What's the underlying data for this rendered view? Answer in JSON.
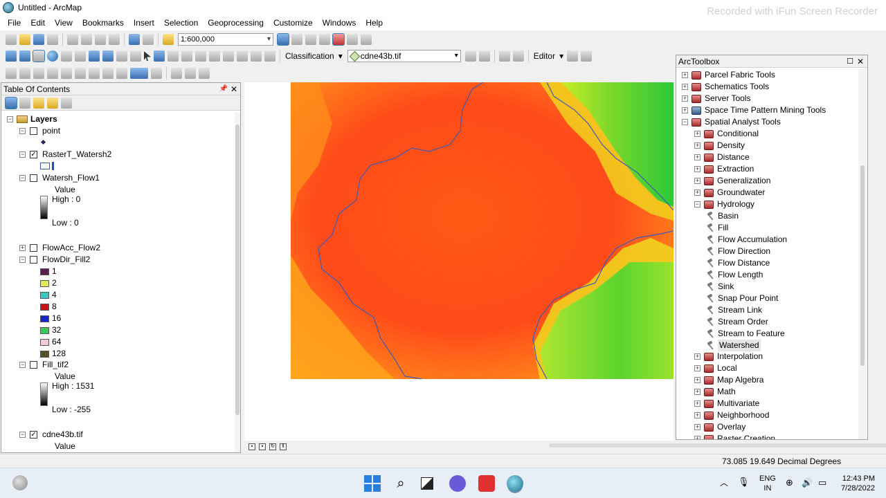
{
  "window": {
    "title": "Untitled - ArcMap",
    "watermark": "Recorded with iFun Screen Recorder"
  },
  "menu": [
    "File",
    "Edit",
    "View",
    "Bookmarks",
    "Insert",
    "Selection",
    "Geoprocessing",
    "Customize",
    "Windows",
    "Help"
  ],
  "toolbar": {
    "scale": "1:600,000",
    "classification_label": "Classification",
    "layer_select": "cdne43b.tif",
    "editor_label": "Editor"
  },
  "toc": {
    "title": "Table Of Contents",
    "root_label": "Layers",
    "layers": {
      "point": {
        "name": "point",
        "checked": false
      },
      "raster_t": {
        "name": "RasterT_Watersh2",
        "checked": true
      },
      "watersh": {
        "name": "Watersh_Flow1",
        "checked": false,
        "value_label": "Value",
        "high": "High : 0",
        "low": "Low : 0"
      },
      "flowacc": {
        "name": "FlowAcc_Flow2",
        "checked": false
      },
      "flowdir": {
        "name": "FlowDir_Fill2",
        "checked": false,
        "classes": [
          {
            "label": "1",
            "color": "#5a1e4a"
          },
          {
            "label": "2",
            "color": "#e6e65a"
          },
          {
            "label": "4",
            "color": "#3cc8c0"
          },
          {
            "label": "8",
            "color": "#c81414"
          },
          {
            "label": "16",
            "color": "#1428c8"
          },
          {
            "label": "32",
            "color": "#3cc85a"
          },
          {
            "label": "64",
            "color": "#f5c8e0"
          },
          {
            "label": "128",
            "color": "#5a5028"
          }
        ]
      },
      "fill": {
        "name": "Fill_tif2",
        "checked": false,
        "value_label": "Value",
        "high": "High : 1531",
        "low": "Low : -255"
      },
      "cdne": {
        "name": "cdne43b.tif",
        "checked": true,
        "value_label": "Value"
      }
    }
  },
  "toolbox": {
    "title": "ArcToolbox",
    "items": {
      "parcel": "Parcel Fabric Tools",
      "schematics": "Schematics Tools",
      "server": "Server Tools",
      "spacetime": "Space Time Pattern Mining Tools",
      "spatial": "Spatial Analyst Tools",
      "conditional": "Conditional",
      "density": "Density",
      "distance": "Distance",
      "extraction": "Extraction",
      "generalization": "Generalization",
      "groundwater": "Groundwater",
      "hydrology": "Hydrology",
      "interpolation": "Interpolation",
      "local": "Local",
      "mapalgebra": "Map Algebra",
      "math": "Math",
      "multivariate": "Multivariate",
      "neighborhood": "Neighborhood",
      "overlay": "Overlay",
      "rastercreation": "Raster Creation"
    },
    "hydrology_tools": [
      "Basin",
      "Fill",
      "Flow Accumulation",
      "Flow Direction",
      "Flow Distance",
      "Flow Length",
      "Sink",
      "Snap Pour Point",
      "Stream Link",
      "Stream Order",
      "Stream to Feature",
      "Watershed"
    ]
  },
  "status": {
    "coords": "73.085  19.649 Decimal Degrees"
  },
  "taskbar": {
    "lang": "ENG",
    "region": "IN",
    "time": "12:43 PM",
    "date": "7/28/2022"
  }
}
